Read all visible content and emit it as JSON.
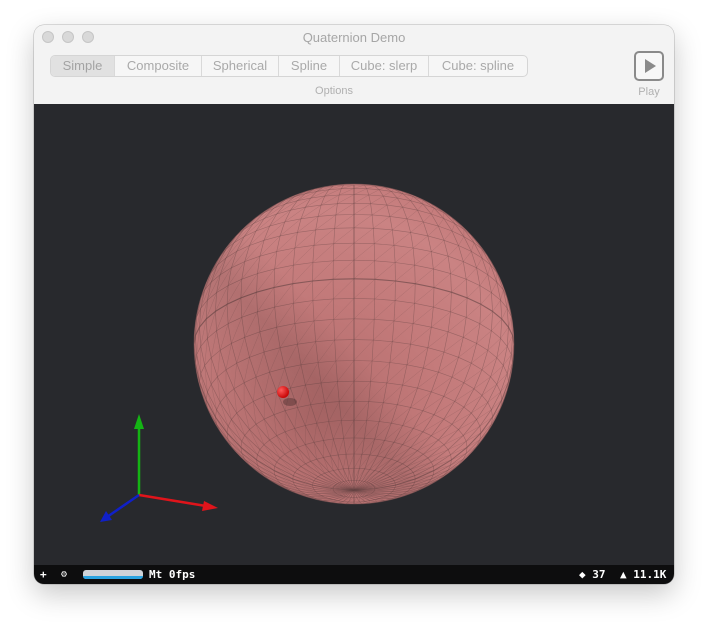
{
  "window": {
    "title": "Quaternion Demo"
  },
  "toolbar": {
    "segments": [
      {
        "label": "Simple",
        "selected": true
      },
      {
        "label": "Composite",
        "selected": false
      },
      {
        "label": "Spherical",
        "selected": false
      },
      {
        "label": "Spline",
        "selected": false
      },
      {
        "label": "Cube: slerp",
        "selected": false
      },
      {
        "label": "Cube: spline",
        "selected": false
      }
    ],
    "options_label": "Options",
    "play_label": "Play",
    "play_icon": "play-triangle-icon"
  },
  "scene": {
    "background_color": "#28292d",
    "sphere_color": "#c87a7a",
    "marker_color": "#e80000",
    "axes": {
      "x_color": "#e0141b",
      "y_color": "#14b414",
      "z_color": "#1020c8"
    }
  },
  "statusbar": {
    "plus": "+",
    "gear_icon": "gear-icon",
    "gear": "⚙",
    "progress": 1.0,
    "fps_text": "Mt 0fps",
    "mesh_text": "◆ 37",
    "triangles_text": "▲ 11.1K"
  }
}
